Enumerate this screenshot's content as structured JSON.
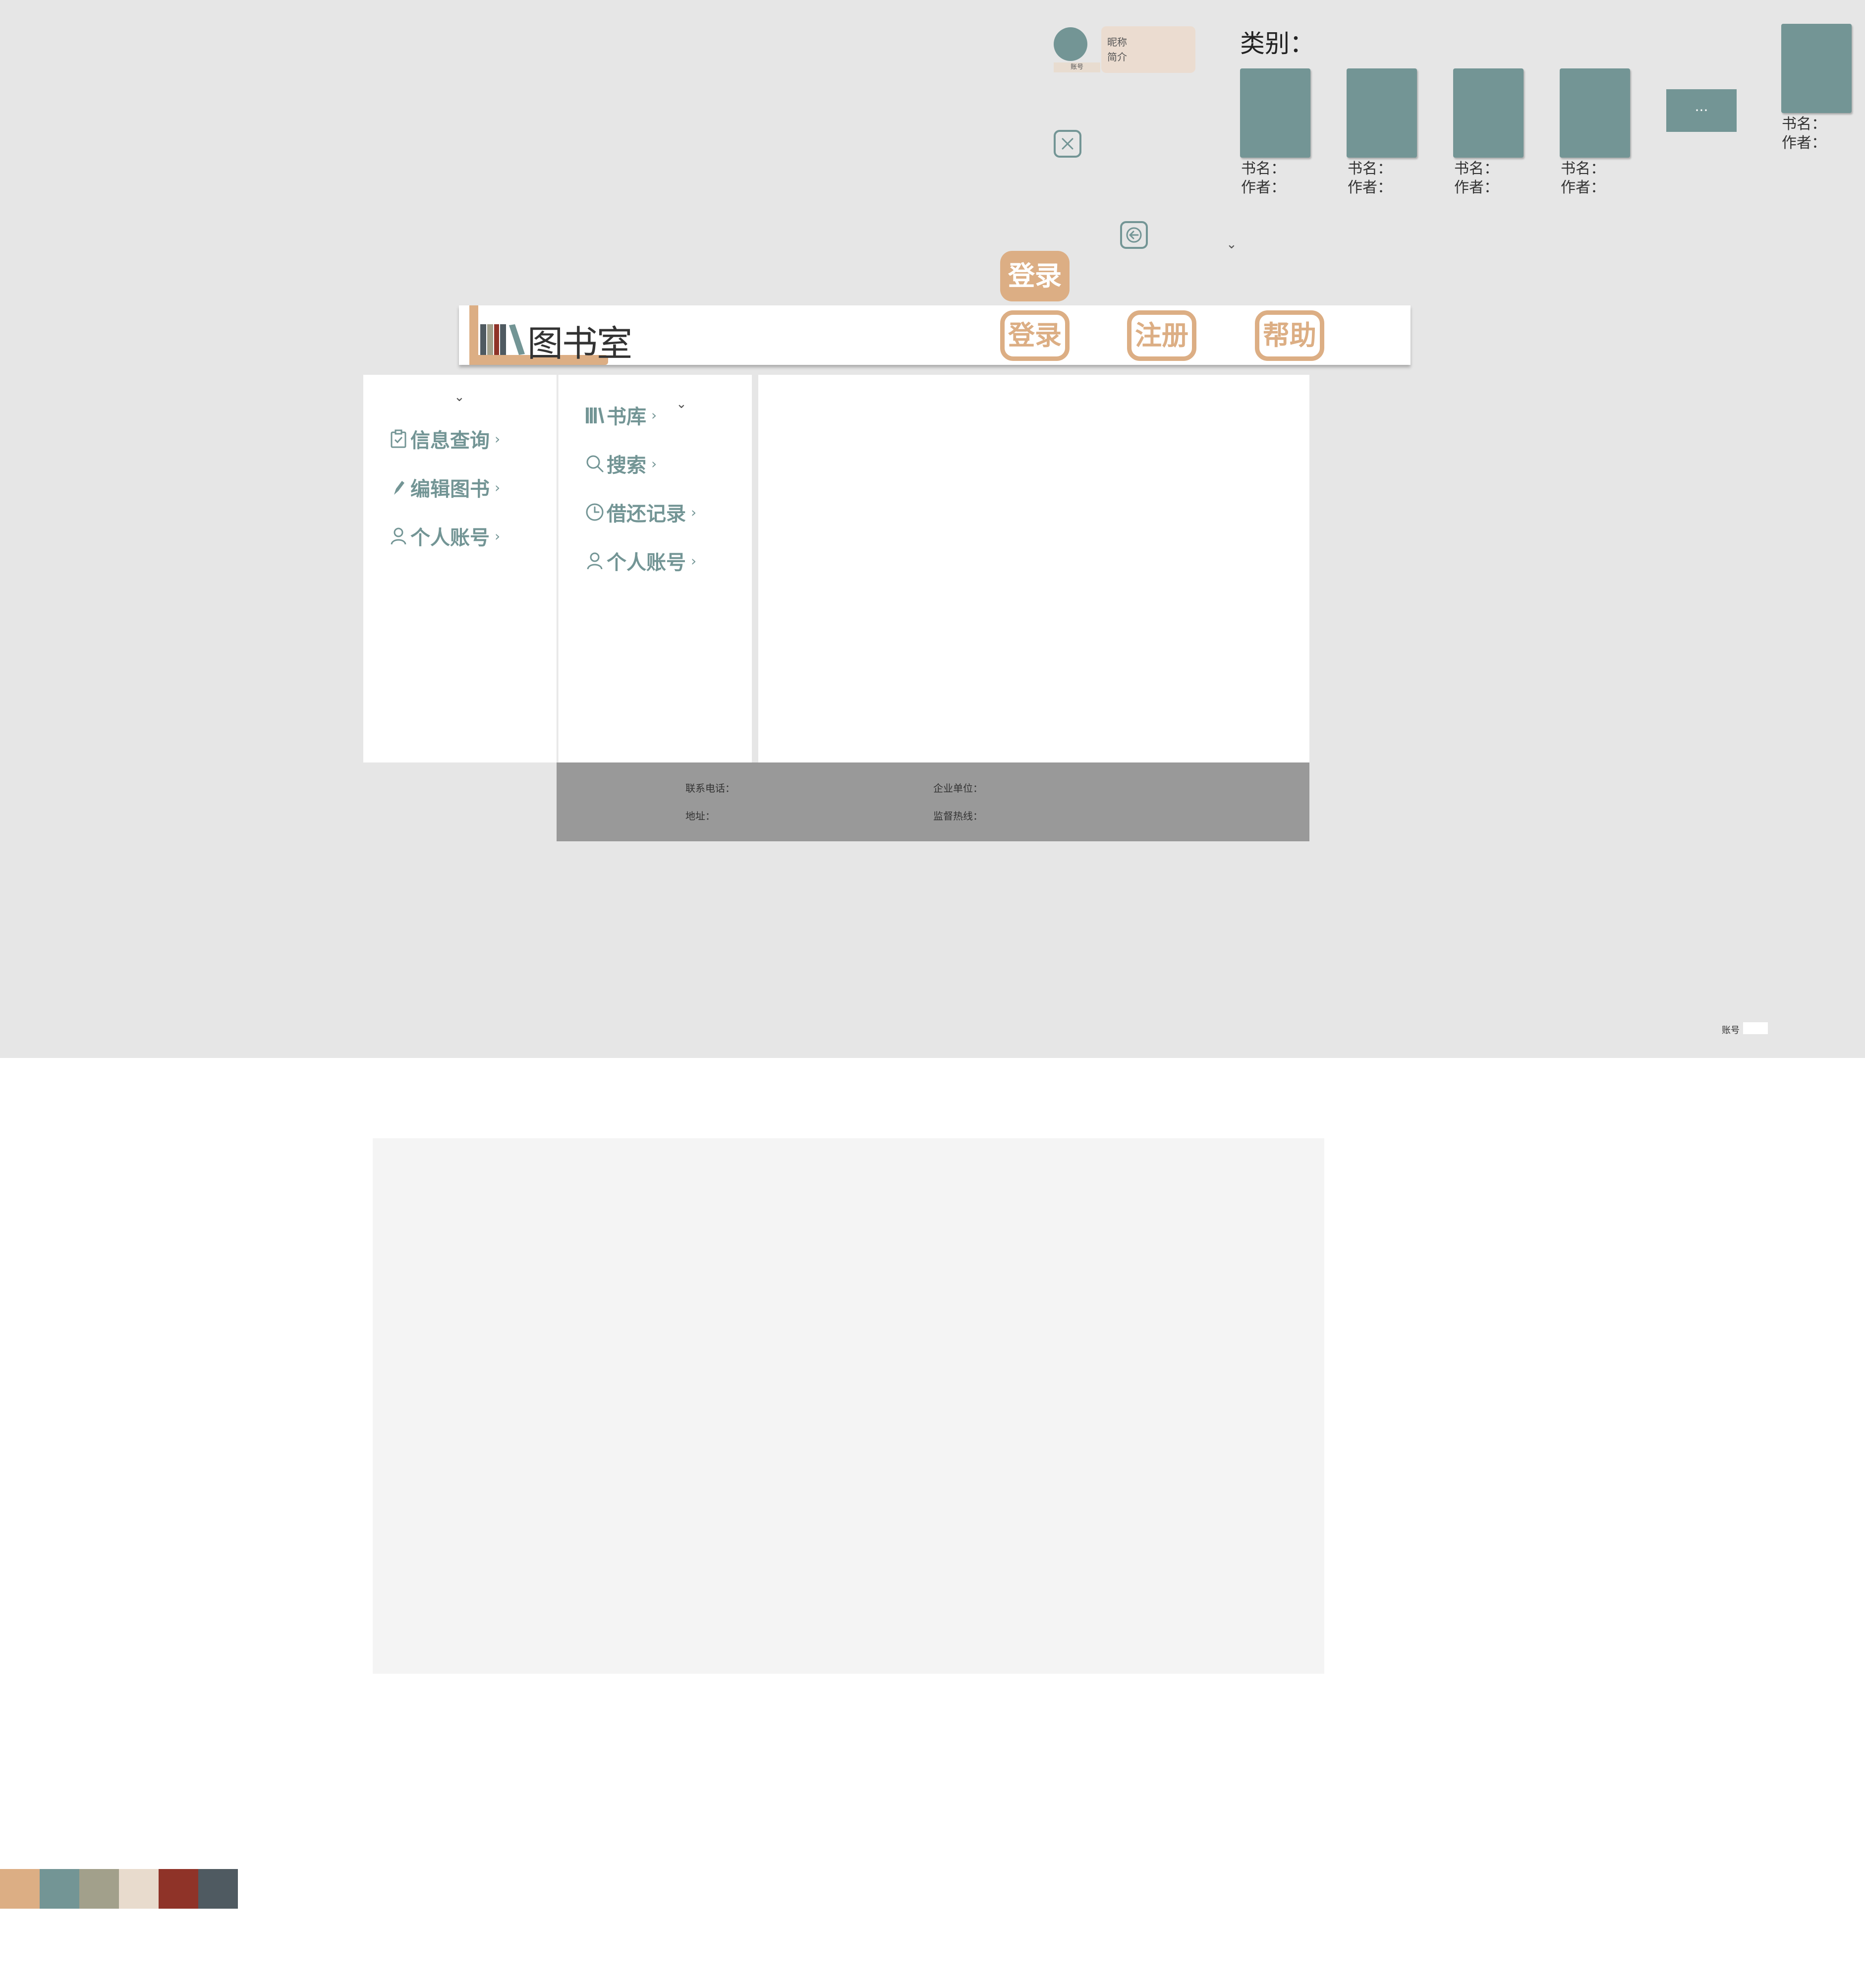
{
  "profile": {
    "account_tag": "账号",
    "nickname": "昵称",
    "intro": "简介"
  },
  "category": {
    "label": "类别：",
    "books": [
      {
        "title_label": "书名：",
        "author_label": "作者："
      },
      {
        "title_label": "书名：",
        "author_label": "作者："
      },
      {
        "title_label": "书名：",
        "author_label": "作者："
      },
      {
        "title_label": "书名：",
        "author_label": "作者："
      }
    ],
    "more_label": "...",
    "extra_book": {
      "title_label": "书名：",
      "author_label": "作者："
    }
  },
  "header": {
    "logo_text": "图书室",
    "login_solid_label": "登录",
    "login_label": "登录",
    "register_label": "注册",
    "help_label": "帮助"
  },
  "sidebar_a": {
    "items": [
      {
        "label": "信息查询",
        "icon": "clipboard-check-icon"
      },
      {
        "label": "编辑图书",
        "icon": "pencil-icon"
      },
      {
        "label": "个人账号",
        "icon": "user-icon"
      }
    ]
  },
  "sidebar_b": {
    "items": [
      {
        "label": "书库",
        "icon": "books-icon"
      },
      {
        "label": "搜索",
        "icon": "search-icon"
      },
      {
        "label": "借还记录",
        "icon": "clock-icon"
      },
      {
        "label": "个人账号",
        "icon": "user-icon"
      }
    ]
  },
  "footer": {
    "phone_label": "联系电话：",
    "company_label": "企业单位：",
    "address_label": "地址：",
    "hotline_label": "监督热线："
  },
  "account_mini": {
    "label": "账号"
  },
  "palette": {
    "colors": [
      "#dcae84",
      "#739595",
      "#a2a08b",
      "#e8dbcd",
      "#8f3328",
      "#4f5a61"
    ]
  }
}
